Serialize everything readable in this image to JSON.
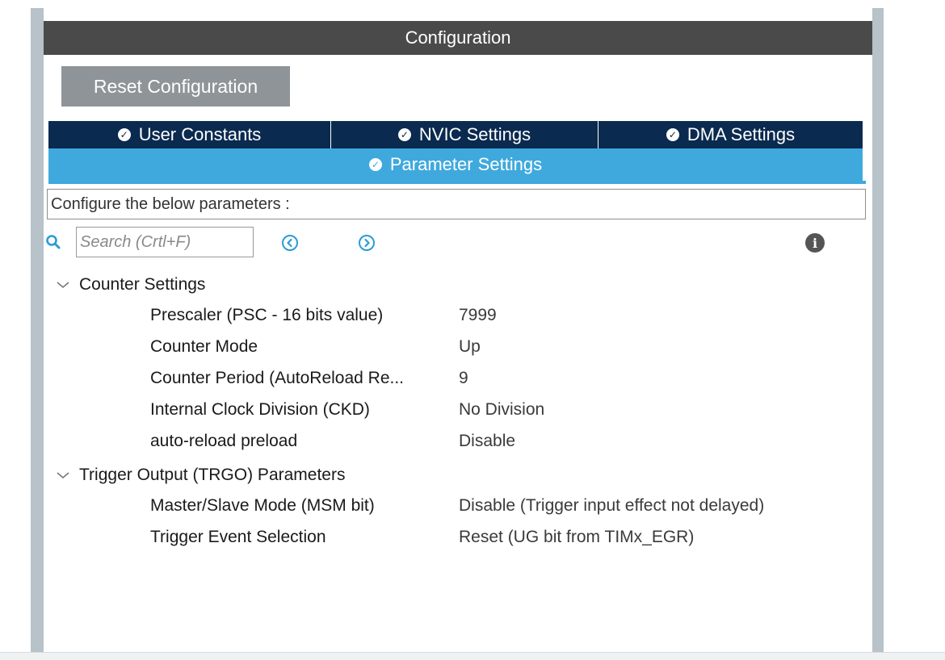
{
  "panel": {
    "title": "Configuration",
    "reset_button": "Reset Configuration"
  },
  "tabs": [
    {
      "label": "User Constants",
      "icon": "check-circle-icon"
    },
    {
      "label": "NVIC Settings",
      "icon": "check-circle-icon"
    },
    {
      "label": "DMA Settings",
      "icon": "check-circle-icon"
    }
  ],
  "active_tab": {
    "label": "Parameter Settings",
    "icon": "check-circle-icon"
  },
  "description": "Configure the below parameters :",
  "search": {
    "placeholder": "Search (Crtl+F)"
  },
  "groups": [
    {
      "label": "Counter Settings",
      "params": [
        {
          "name": "Prescaler (PSC - 16 bits value)",
          "value": "7999"
        },
        {
          "name": "Counter Mode",
          "value": "Up"
        },
        {
          "name": "Counter Period (AutoReload Re...",
          "value": "9"
        },
        {
          "name": "Internal Clock Division (CKD)",
          "value": "No Division"
        },
        {
          "name": "auto-reload preload",
          "value": "Disable"
        }
      ]
    },
    {
      "label": "Trigger Output (TRGO) Parameters",
      "params": [
        {
          "name": "Master/Slave Mode (MSM bit)",
          "value": "Disable (Trigger input effect not delayed)"
        },
        {
          "name": "Trigger Event Selection",
          "value": "Reset (UG bit from TIMx_EGR)"
        }
      ]
    }
  ],
  "colors": {
    "title_bar": "#4a4a4a",
    "tab_bar": "#0a2a4f",
    "active_tab": "#3fa9dd",
    "reset_button": "#8f9499",
    "nav_icon": "#2a9bd6"
  }
}
